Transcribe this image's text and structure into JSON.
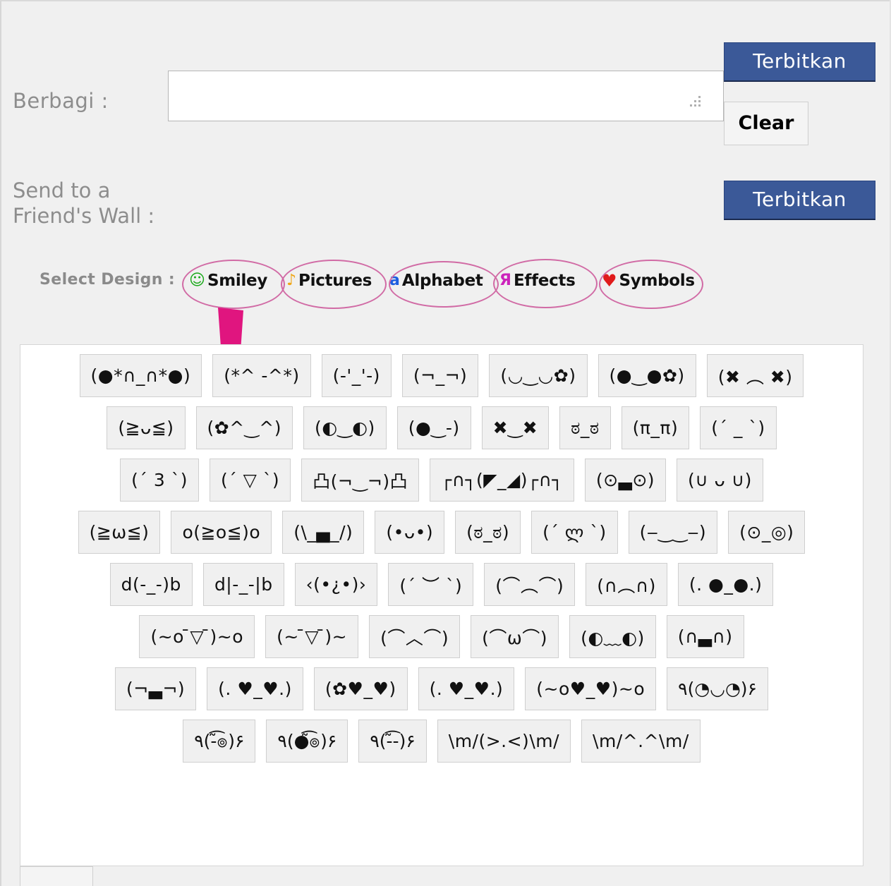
{
  "share": {
    "label": "Berbagi :",
    "input_value": "",
    "input_placeholder": "",
    "resize_grip": "resize-grip-icon"
  },
  "buttons": {
    "publish_top": "Terbitkan",
    "clear": "Clear",
    "publish_friend": "Terbitkan"
  },
  "friend": {
    "label": "Send to a\nFriend's Wall :"
  },
  "design": {
    "label": "Select Design :",
    "links": [
      {
        "icon": "smiley-icon",
        "glyph": "☺",
        "label": "Smiley",
        "color": "#18a818"
      },
      {
        "icon": "music-note-icon",
        "glyph": "♪",
        "label": "Pictures",
        "color": "#efa616"
      },
      {
        "icon": "letter-a-icon",
        "glyph": "a",
        "label": "Alphabet",
        "color": "#1c5ee0"
      },
      {
        "icon": "reversed-r-icon",
        "glyph": "Я",
        "label": "Effects",
        "color": "#cc22bb"
      },
      {
        "icon": "heart-icon",
        "glyph": "♥",
        "label": "Symbols",
        "color": "#e01b1b"
      }
    ],
    "annotation_color": "#d16ba5",
    "arrow_color": "#e0157f"
  },
  "emoticons": {
    "rows": [
      [
        "(●*∩_∩*●)",
        "(*^ -^*)",
        "(-'_'-)",
        "(¬_¬)",
        "(◡‿◡✿)",
        "(●‿●✿)",
        "(✖ ︵ ✖)"
      ],
      [
        "(≧ᴗ≦)",
        "(✿^‿^)",
        "(◐‿◐)",
        "(●‿-)",
        "✖‿✖",
        "ಠ_ಠ",
        "(π_π)",
        "(´ _ `)"
      ],
      [
        "(´ 3 `)",
        "(´ ▽ `)",
        "凸(¬‿¬)凸",
        "┌∩┐(◤_◢)┌∩┐",
        "(⊙▃⊙)",
        "(∪ ᴗ ∪)"
      ],
      [
        "(≧ω≦)",
        "o(≧o≦)o",
        "(\\_▄_/)",
        "(•ᴗ•)",
        "(ಠ_ಠ)",
        "(´ ლ `)",
        "(‒‿‿‒)",
        "(⊙_◎)"
      ],
      [
        "d(-_-)b",
        "d|-_-|b",
        "‹(•¿•)›",
        "(´ ︶ `)",
        "(⌒︵⌒)",
        "(∩︵∩)",
        "(. ●_●.)"
      ],
      [
        "(~o ̄▽ ̄)~o",
        "(~ ̄▽ ̄)~",
        "(⌒︿⌒)",
        "(⌒ω⌒)",
        "(◐﹏◐)",
        "(∩▃∩)"
      ],
      [
        "(¬▃¬)",
        "(. ♥_♥.)",
        "(✿♥_♥)",
        "(. ♥_♥.)",
        "(~o♥_♥)~o",
        "٩(◔◡◔)۶"
      ],
      [
        "٩(-̃͡๏)۶",
        "٩(●̃͡๏)۶",
        "٩(-̃͡-)۶",
        "\\m/(>.<)\\m/",
        "\\m/^.^\\m/"
      ]
    ]
  }
}
